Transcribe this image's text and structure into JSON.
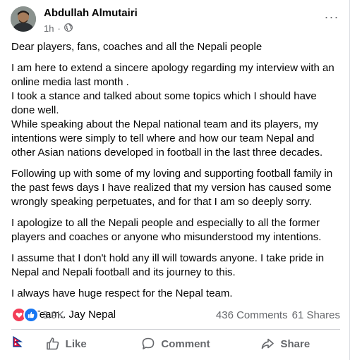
{
  "post": {
    "author": "Abdullah Almutairi",
    "time": "1h",
    "dot": "·",
    "more_label": "···",
    "paragraphs": [
      "Dear  players, fans, coaches and all the Nepali people",
      "I am here to extend a sincere apology regarding my interview with an\nonline media last month .\nI took a stance and talked about some topics which I should have\ndone well.\nWhile speaking about the Nepal national team and its players, my\nintentions were simply to tell where and how our team Nepal and\nother Asian nations developed in football in the last three decades.",
      "Following up with some of my loving and supporting football family in\nthe past fews days I have realized that my version has caused some\nwrongly speaking perpetuates, and for that I am so deeply sorry.",
      "I apologize to all the Nepali people and especially to all the former\nplayers and coaches or anyone who misunderstood my intentions.",
      "I assume that I don't hold any ill will towards anyone. I take pride in\nNepal and Nepali football and its journey to this.",
      "I always have huge respect for the Nepal team."
    ],
    "closing": "One Team.. Jay Nepal"
  },
  "stats": {
    "reaction_count": "3.9K",
    "comments": "436 Comments",
    "shares": "61 Shares"
  },
  "actions": {
    "like": "Like",
    "comment": "Comment",
    "share": "Share"
  },
  "colors": {
    "like_blue": "#1877f2",
    "love_red": "#f33e58",
    "secondary_text": "#65676b",
    "divider": "#ced0d4",
    "flag_crimson": "#dc143c",
    "flag_blue": "#003893"
  },
  "icons": [
    "globe-icon",
    "more-options-icon",
    "love-reaction-icon",
    "like-reaction-icon",
    "nepal-flag-icon",
    "like-icon",
    "comment-icon",
    "share-icon"
  ]
}
